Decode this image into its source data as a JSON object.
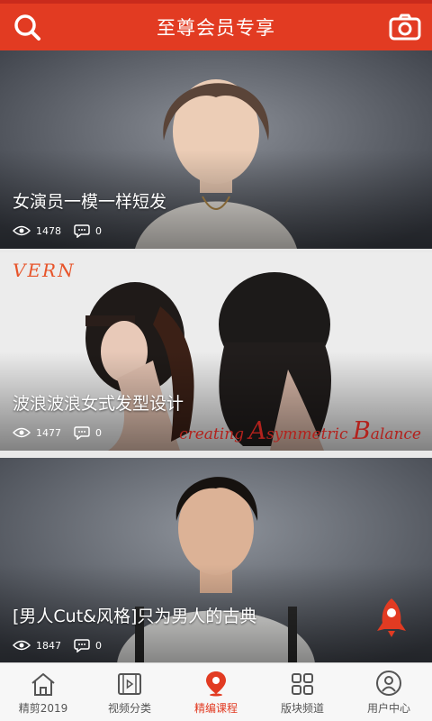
{
  "header": {
    "title": "至尊会员专享",
    "left_icon": "search-icon",
    "right_icon": "camera-icon",
    "color": "#e23b22"
  },
  "cards": [
    {
      "title": "女演员一模一样短发",
      "views": "1478",
      "comments": "0"
    },
    {
      "title": "波浪波浪女式发型设计",
      "views": "1477",
      "comments": "0",
      "logo": "VERN",
      "tagline": {
        "t1": "creating ",
        "a": "A",
        "t2": "symmetric ",
        "b": "B",
        "t3": "alance"
      }
    },
    {
      "title": "[男人Cut&风格]只为男人的古典",
      "views": "1847",
      "comments": "0"
    }
  ],
  "fab_icon": "rocket-icon",
  "tabs": [
    {
      "label": "精剪2019",
      "icon": "home-icon",
      "active": false
    },
    {
      "label": "视频分类",
      "icon": "film-icon",
      "active": false
    },
    {
      "label": "精编课程",
      "icon": "location-pin-icon",
      "active": true
    },
    {
      "label": "版块频道",
      "icon": "grid-icon",
      "active": false
    },
    {
      "label": "用户中心",
      "icon": "user-icon",
      "active": false
    }
  ],
  "colors": {
    "accent": "#e23b22",
    "tab_inactive": "#555555"
  }
}
